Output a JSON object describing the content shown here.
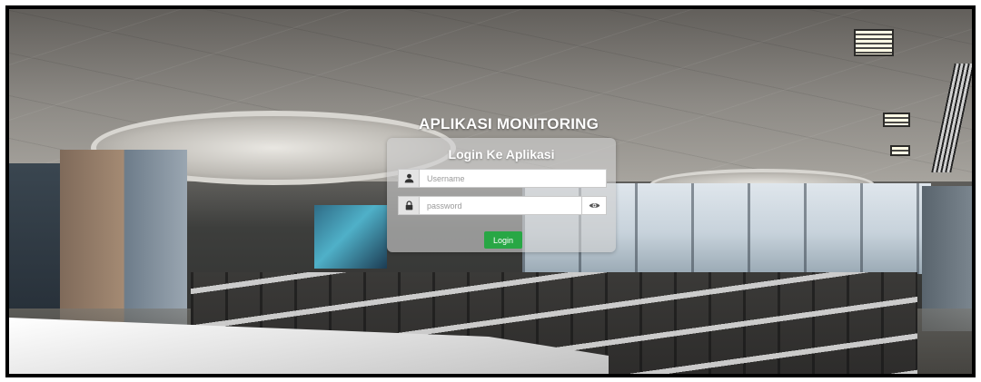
{
  "app_title": "APLIKASI MONITORING",
  "login": {
    "heading": "Login Ke Aplikasi",
    "username": {
      "placeholder": "Username",
      "value": "",
      "icon": "user-icon"
    },
    "password": {
      "placeholder": "password",
      "value": "",
      "icon": "lock-icon",
      "toggle_icon": "eye-icon"
    },
    "submit_label": "Login"
  },
  "colors": {
    "primary_button": "#28a745",
    "title_text": "#ffffff",
    "card_background": "rgba(206,206,206,0.62)"
  },
  "background": {
    "description_icon": "office-cafeteria-photo"
  }
}
